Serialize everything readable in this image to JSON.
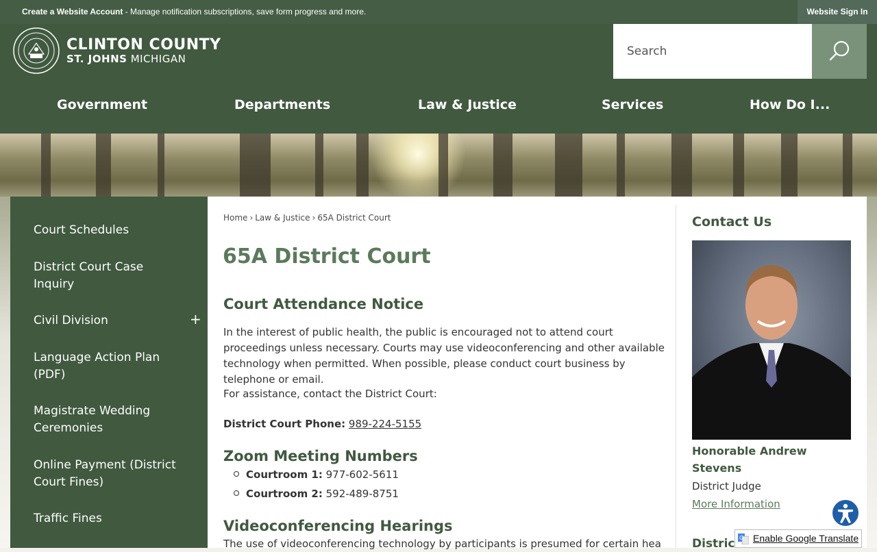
{
  "topbar": {
    "create_account_bold": "Create a Website Account",
    "create_account_rest": " - Manage notification subscriptions, save form progress and more.",
    "sign_in": "Website Sign In"
  },
  "logo": {
    "line1": "CLINTON COUNTY",
    "line2_bold": "ST. JOHNS",
    "line2_rest": " MICHIGAN",
    "seal_icon": "county-seal-icon"
  },
  "search": {
    "placeholder": "Search",
    "icon": "search-icon"
  },
  "nav": [
    "Government",
    "Departments",
    "Law & Justice",
    "Services",
    "How Do I..."
  ],
  "sidebar": {
    "items": [
      {
        "label": "Court Schedules"
      },
      {
        "label": "District Court Case Inquiry"
      },
      {
        "label": "Civil Division",
        "toggle": "+"
      },
      {
        "label": "Language Action Plan (PDF)"
      },
      {
        "label": "Magistrate Wedding Ceremonies"
      },
      {
        "label": "Online Payment (District Court Fines)"
      },
      {
        "label": "Traffic Fines"
      }
    ]
  },
  "breadcrumb": {
    "home": "Home",
    "sep": "›",
    "law": "Law & Justice",
    "current": "65A District Court"
  },
  "main": {
    "title": "65A District Court",
    "attendance_heading": "Court Attendance Notice",
    "attendance_text": "In the interest of public health, the public is encouraged not to attend court proceedings unless necessary. Courts may use videoconferencing and other available technology when permitted. When possible, please conduct court business by telephone or email.",
    "assistance_text": "For assistance, contact the District Court:",
    "phone_label": "District Court Phone:",
    "phone_value": "989-224-5155",
    "zoom_heading": "Zoom Meeting Numbers",
    "courtrooms": [
      {
        "label": "Courtroom 1:",
        "value": "977-602-5611"
      },
      {
        "label": "Courtroom 2:",
        "value": "592-489-8751"
      }
    ],
    "video_heading": "Videoconferencing Hearings",
    "video_text": "The use of videoconferencing technology by participants is presumed for certain hearings"
  },
  "contact": {
    "title": "Contact Us",
    "judge_name": "Honorable Andrew Stevens",
    "judge_role": "District Judge",
    "more_info": "More Information",
    "next_heading": "District"
  },
  "widgets": {
    "accessibility_icon": "accessibility-icon",
    "translate_label": "Enable Google Translate"
  },
  "colors": {
    "header_green": "#40593f",
    "accent_green": "#5b7a5b",
    "search_button": "#7a9279"
  }
}
